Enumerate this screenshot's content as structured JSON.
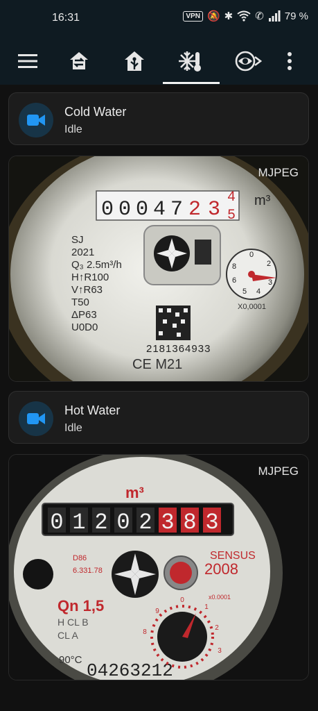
{
  "status": {
    "time": "16:31",
    "vpn": "VPN",
    "battery": "79 %"
  },
  "toolbar": {
    "icons": [
      "menu-icon",
      "home-swap-icon",
      "home-automation-icon",
      "thermostat-snowflake-icon",
      "camera-eye-icon",
      "more-vert-icon"
    ],
    "active_tab": 3
  },
  "cameras": [
    {
      "name": "Cold Water",
      "state": "Idle",
      "stream_label": "MJPEG",
      "meter": {
        "reading": "00047234",
        "unit": "m³",
        "last_digit_alt": "5",
        "brand_lines": [
          "SJ",
          "2021",
          "Q₃ 2.5m³/h",
          "H↑R100",
          "V↑R63",
          "T50",
          "ΔP63",
          "U0D0"
        ],
        "serial": "2181364933",
        "mark": "CE M21",
        "dial_label": "X0,0001",
        "dial_numbers": [
          "0",
          "2",
          "3",
          "4",
          "5",
          "6",
          "8"
        ]
      }
    },
    {
      "name": "Hot Water",
      "state": "Idle",
      "stream_label": "MJPEG",
      "meter": {
        "reading": "01202383",
        "unit": "m³",
        "brand": "SENSUS",
        "year": "2008",
        "rating": "Qn 1,5",
        "small_codes": [
          "D86",
          "6.331.78"
        ],
        "class_lines": [
          "H CL B",
          "CL A"
        ],
        "temp": "90°C",
        "serial": "04263212",
        "dial_label": "x0.0001",
        "dial_numbers": [
          "0",
          "1",
          "2",
          "3",
          "8",
          "9"
        ]
      }
    }
  ],
  "colors": {
    "accent": "#2196f3",
    "toolbar": "#0f1b22",
    "card": "#1c1c1c",
    "meter_red": "#c0282d"
  }
}
